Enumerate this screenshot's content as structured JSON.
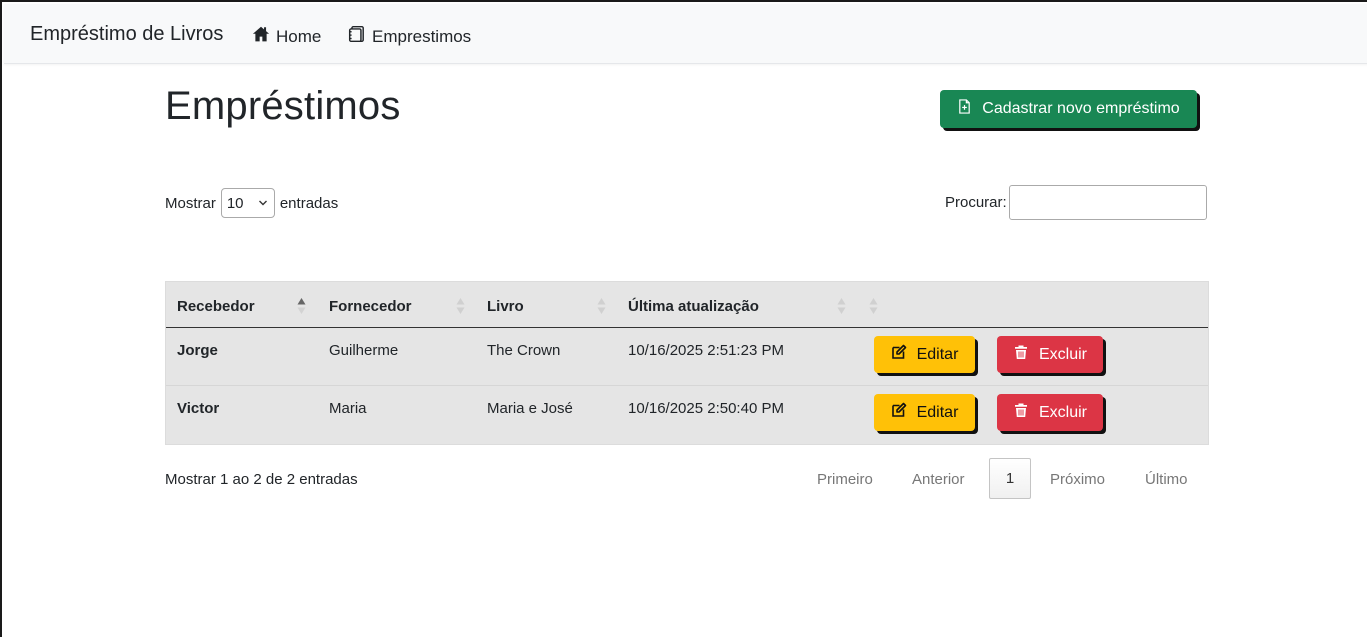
{
  "navbar": {
    "brand": "Empréstimo de Livros",
    "links": [
      {
        "label": "Home",
        "icon": "home-icon"
      },
      {
        "label": "Emprestimos",
        "icon": "notebook-icon"
      }
    ]
  },
  "page": {
    "title": "Empréstimos",
    "new_button_label": "Cadastrar novo empréstimo",
    "new_button_icon": "file-plus-icon"
  },
  "length": {
    "prefix": "Mostrar",
    "value": "10",
    "suffix": "entradas"
  },
  "search": {
    "label": "Procurar:",
    "value": ""
  },
  "table": {
    "columns": [
      "Recebedor",
      "Fornecedor",
      "Livro",
      "Última atualização",
      ""
    ],
    "sorted_column": "Recebedor",
    "sort_direction": "asc",
    "rows": [
      {
        "recebedor": "Jorge",
        "fornecedor": "Guilherme",
        "livro": "The Crown",
        "atualizacao": "10/16/2025 2:51:23 PM",
        "edit_label": "Editar",
        "delete_label": "Excluir"
      },
      {
        "recebedor": "Victor",
        "fornecedor": "Maria",
        "livro": "Maria e José",
        "atualizacao": "10/16/2025 2:50:40 PM",
        "edit_label": "Editar",
        "delete_label": "Excluir"
      }
    ]
  },
  "footer": {
    "info": "Mostrar 1 ao 2 de 2 entradas",
    "pagination": {
      "first": "Primeiro",
      "previous": "Anterior",
      "current": "1",
      "next": "Próximo",
      "last": "Último"
    }
  },
  "colors": {
    "success": "#198754",
    "warning": "#ffc107",
    "danger": "#dc3545",
    "navbar_bg": "#f8f9fa",
    "table_bg": "#e5e5e5"
  }
}
